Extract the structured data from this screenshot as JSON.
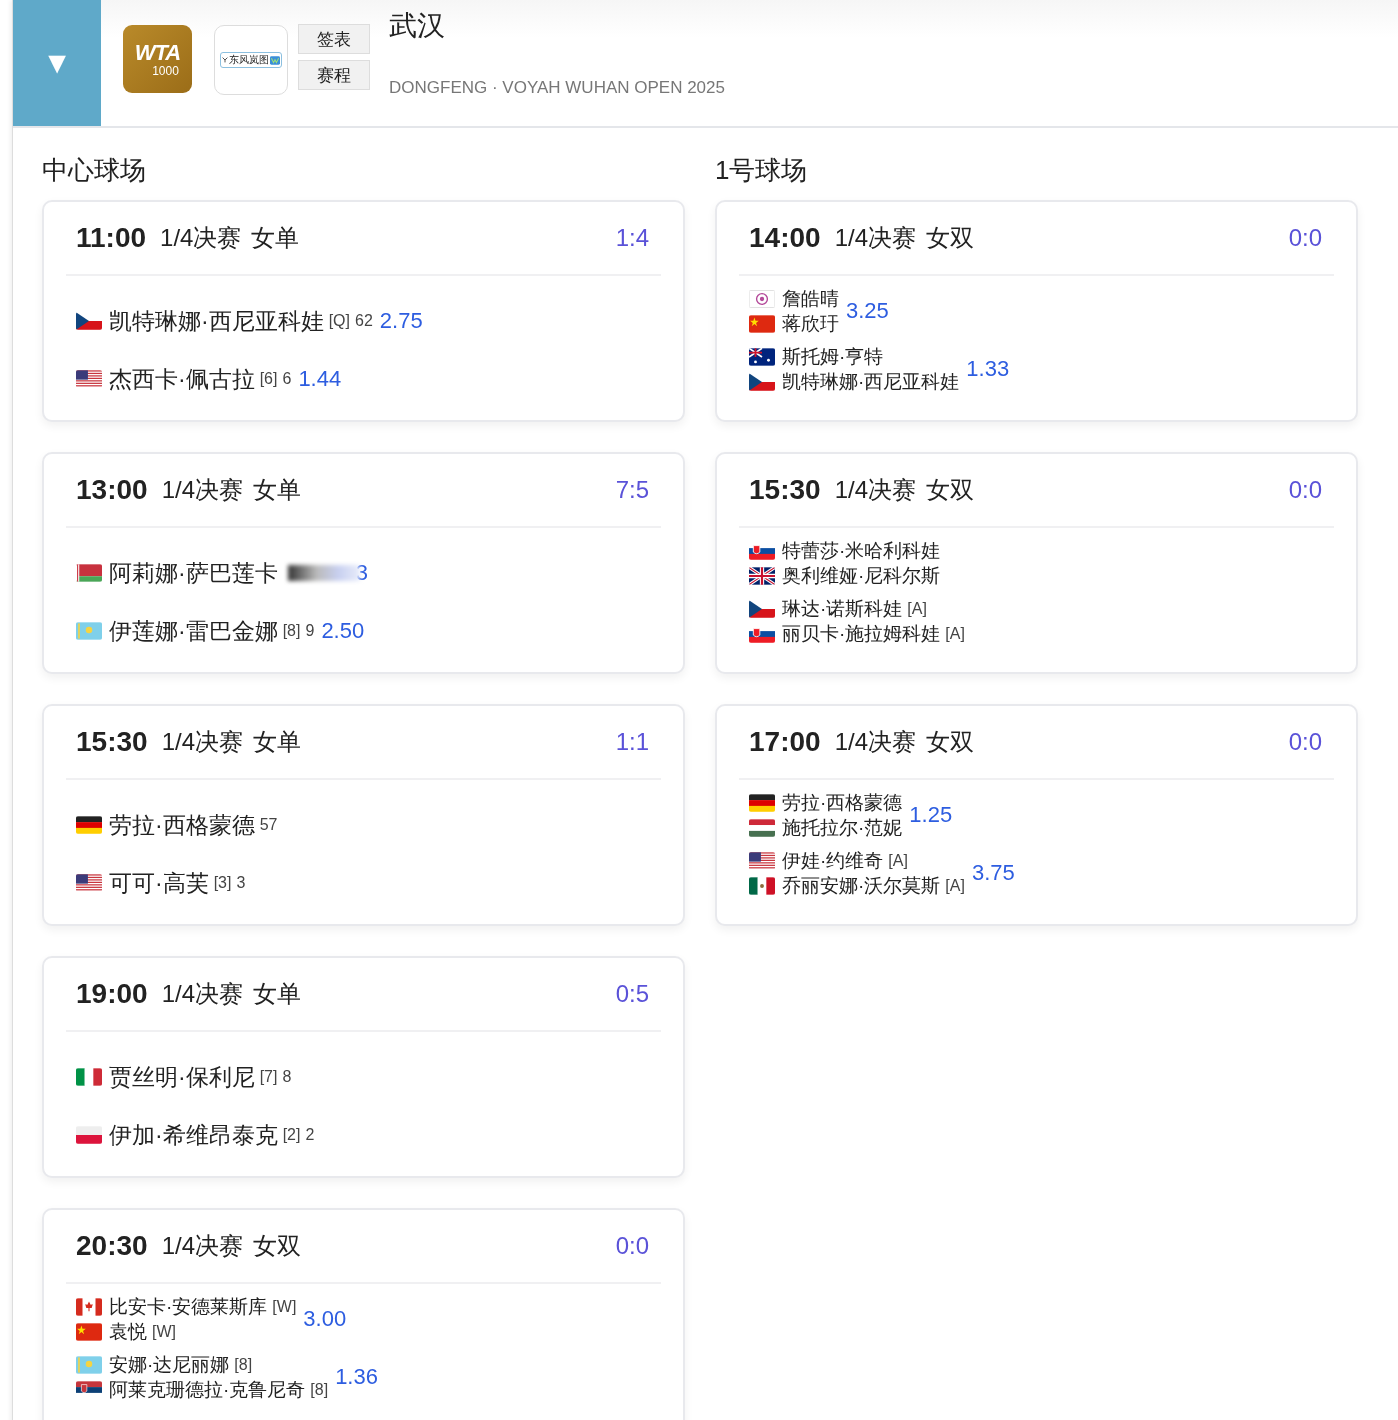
{
  "header": {
    "toggle": "▼",
    "logo": {
      "line1": "WTA",
      "line2": "1000"
    },
    "sponsor_logo": "东风岚图",
    "buttons": [
      "签表",
      "赛程"
    ],
    "title": "武汉",
    "subtitle": "DONGFENG · VOYAH WUHAN OPEN 2025"
  },
  "courts": [
    {
      "name": "中心球场",
      "matches": [
        {
          "time": "11:00",
          "round": "1/4决赛",
          "event": "女单",
          "kind": "singles",
          "score": "1:4",
          "sides": [
            {
              "players": [
                {
                  "kind": "cz",
                  "name": "凯特琳娜·西尼亚科娃",
                  "seed": "[Q]",
                  "games": "62"
                }
              ],
              "odds": "2.75"
            },
            {
              "players": [
                {
                  "kind": "us",
                  "name": "杰西卡·佩古拉",
                  "seed": "[6]",
                  "games": "6"
                }
              ],
              "odds": "1.44"
            }
          ]
        },
        {
          "time": "13:00",
          "round": "1/4决赛",
          "event": "女单",
          "kind": "singles",
          "score": "7:5",
          "sides": [
            {
              "players": [
                {
                  "kind": "by",
                  "name": "阿莉娜·萨巴莲卡"
                }
              ],
              "masked": true,
              "odds": "3"
            },
            {
              "players": [
                {
                  "kind": "kz",
                  "name": "伊莲娜·雷巴金娜",
                  "seed": "[8]",
                  "games": "9"
                }
              ],
              "odds": "2.50"
            }
          ]
        },
        {
          "time": "15:30",
          "round": "1/4决赛",
          "event": "女单",
          "kind": "singles",
          "score": "1:1",
          "sides": [
            {
              "players": [
                {
                  "kind": "de",
                  "name": "劳拉·西格蒙德",
                  "games": "57"
                }
              ]
            },
            {
              "players": [
                {
                  "kind": "us",
                  "name": "可可·高芙",
                  "seed": "[3]",
                  "games": "3"
                }
              ]
            }
          ]
        },
        {
          "time": "19:00",
          "round": "1/4决赛",
          "event": "女单",
          "kind": "singles",
          "score": "0:5",
          "sides": [
            {
              "players": [
                {
                  "kind": "it",
                  "name": "贾丝明·保利尼",
                  "seed": "[7]",
                  "games": "8"
                }
              ]
            },
            {
              "players": [
                {
                  "kind": "pl",
                  "name": "伊加·希维昂泰克",
                  "seed": "[2]",
                  "games": "2"
                }
              ]
            }
          ]
        },
        {
          "time": "20:30",
          "round": "1/4决赛",
          "event": "女双",
          "kind": "doubles",
          "score": "0:0",
          "sides": [
            {
              "players": [
                {
                  "kind": "ca",
                  "name": "比安卡·安德莱斯库",
                  "seed": "[W]"
                },
                {
                  "kind": "cn",
                  "name": "袁悦",
                  "seed": "[W]"
                }
              ],
              "odds": "3.00"
            },
            {
              "players": [
                {
                  "kind": "kz",
                  "name": "安娜·达尼丽娜",
                  "seed": "[8]"
                },
                {
                  "kind": "rs",
                  "name": "阿莱克珊德拉·克鲁尼奇",
                  "seed": "[8]"
                }
              ],
              "odds": "1.36"
            }
          ]
        }
      ]
    },
    {
      "name": "1号球场",
      "matches": [
        {
          "time": "14:00",
          "round": "1/4决赛",
          "event": "女双",
          "kind": "doubles",
          "score": "0:0",
          "sides": [
            {
              "players": [
                {
                  "kind": "tw",
                  "name": "詹皓晴"
                },
                {
                  "kind": "cn",
                  "name": "蒋欣玗"
                }
              ],
              "odds": "3.25"
            },
            {
              "players": [
                {
                  "kind": "au",
                  "name": "斯托姆·亨特"
                },
                {
                  "kind": "cz",
                  "name": "凯特琳娜·西尼亚科娃"
                }
              ],
              "odds": "1.33"
            }
          ]
        },
        {
          "time": "15:30",
          "round": "1/4决赛",
          "event": "女双",
          "kind": "doubles",
          "score": "0:0",
          "sides": [
            {
              "players": [
                {
                  "kind": "sk",
                  "name": "特蕾莎·米哈利科娃"
                },
                {
                  "kind": "gb",
                  "name": "奥利维娅·尼科尔斯"
                }
              ]
            },
            {
              "players": [
                {
                  "kind": "cz",
                  "name": "琳达·诺斯科娃",
                  "seed": "[A]"
                },
                {
                  "kind": "sk",
                  "name": "丽贝卡·施拉姆科娃",
                  "seed": "[A]"
                }
              ]
            }
          ]
        },
        {
          "time": "17:00",
          "round": "1/4决赛",
          "event": "女双",
          "kind": "doubles",
          "score": "0:0",
          "sides": [
            {
              "players": [
                {
                  "kind": "de",
                  "name": "劳拉·西格蒙德"
                },
                {
                  "kind": "hu",
                  "name": "施托拉尔·范妮"
                }
              ],
              "odds": "1.25"
            },
            {
              "players": [
                {
                  "kind": "us",
                  "name": "伊娃·约维奇",
                  "seed": "[A]"
                },
                {
                  "kind": "mx",
                  "name": "乔丽安娜·沃尔莫斯",
                  "seed": "[A]"
                }
              ],
              "odds": "3.75"
            }
          ]
        }
      ]
    }
  ]
}
